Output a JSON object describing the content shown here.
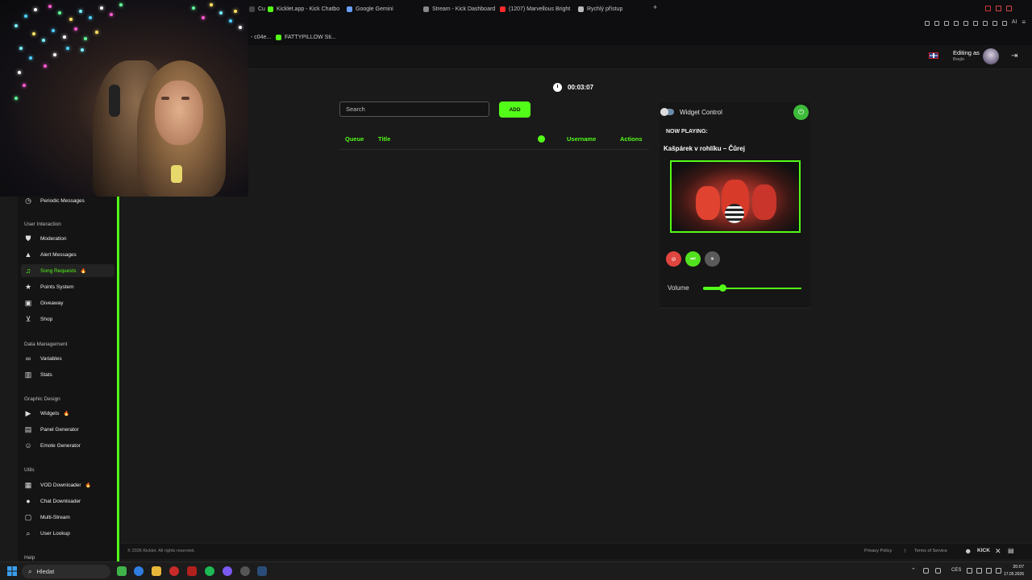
{
  "browser": {
    "tabs": [
      {
        "label": "Cu",
        "color": "#444"
      },
      {
        "label": "Kicklet.app - Kick Chatbo",
        "color": "#53fc18"
      },
      {
        "label": "Google Gemini",
        "color": "#6aa0ff"
      },
      {
        "label": "Stream - Kick Dashboard",
        "color": "#888"
      },
      {
        "label": "(1207) Marvellous Bright",
        "color": "#ff2a2a"
      },
      {
        "label": "Rychlý přístup",
        "color": "#bbb"
      }
    ],
    "new_tab_label": "+",
    "bookmarks": [
      "- c04e...",
      "FATTYPILLOW Sti..."
    ],
    "toolbar_ai_label": "AI"
  },
  "header": {
    "user_label": "Editing as",
    "user_name": "Brejlo",
    "flag_icon": "uk-flag-icon",
    "logout_icon": "logout-icon"
  },
  "sidebar": {
    "top_item": {
      "label": "Periodic Messages",
      "icon": "clock-icon"
    },
    "sections": [
      {
        "title": "User Interaction",
        "items": [
          {
            "label": "Moderation",
            "icon": "shield-icon",
            "fire": false,
            "active": false
          },
          {
            "label": "Alert Messages",
            "icon": "warning-icon",
            "fire": false,
            "active": false
          },
          {
            "label": "Song Requests",
            "icon": "music-icon",
            "fire": true,
            "active": true
          },
          {
            "label": "Points System",
            "icon": "star-icon",
            "fire": false,
            "active": false
          },
          {
            "label": "Giveaway",
            "icon": "gift-icon",
            "fire": false,
            "active": false
          },
          {
            "label": "Shop",
            "icon": "cart-icon",
            "fire": false,
            "active": false
          }
        ]
      },
      {
        "title": "Data Management",
        "items": [
          {
            "label": "Variables",
            "icon": "link-icon",
            "fire": false,
            "active": false
          },
          {
            "label": "Stats",
            "icon": "bar-chart-icon",
            "fire": false,
            "active": false
          }
        ]
      },
      {
        "title": "Graphic Design",
        "items": [
          {
            "label": "Widgets",
            "icon": "video-icon",
            "fire": true,
            "active": false
          },
          {
            "label": "Panel Generator",
            "icon": "panel-icon",
            "fire": false,
            "active": false
          },
          {
            "label": "Emote Generator",
            "icon": "emote-icon",
            "fire": false,
            "active": false
          }
        ]
      },
      {
        "title": "Utils",
        "items": [
          {
            "label": "VOD Downloader",
            "icon": "film-icon",
            "fire": true,
            "active": false
          },
          {
            "label": "Chat Downloader",
            "icon": "chat-icon",
            "fire": false,
            "active": false
          },
          {
            "label": "Multi-Stream",
            "icon": "window-icon",
            "fire": false,
            "active": false
          },
          {
            "label": "User Lookup",
            "icon": "search-icon",
            "fire": false,
            "active": false
          }
        ]
      }
    ],
    "help_label": "Help"
  },
  "queue": {
    "timer": "00:03:07",
    "search_placeholder": "Search",
    "add_label": "ADD",
    "columns": {
      "queue": "Queue",
      "title": "Title",
      "username": "Username",
      "actions": "Actions"
    }
  },
  "widget": {
    "title": "Widget Control",
    "now_playing_label": "NOW PLAYING:",
    "song_title": "Kašpárek v rohlíku – Čůrej",
    "volume_label": "Volume",
    "volume_level": 0.2
  },
  "footer": {
    "copyright": "© 2026 Kicklet. All rights reserved.",
    "privacy": "Privacy Policy",
    "separator": "|",
    "terms": "Terms of Service"
  },
  "taskbar": {
    "search_label": "Hledat",
    "language": "CES",
    "time": "20:07",
    "date": "17.05.2026"
  }
}
